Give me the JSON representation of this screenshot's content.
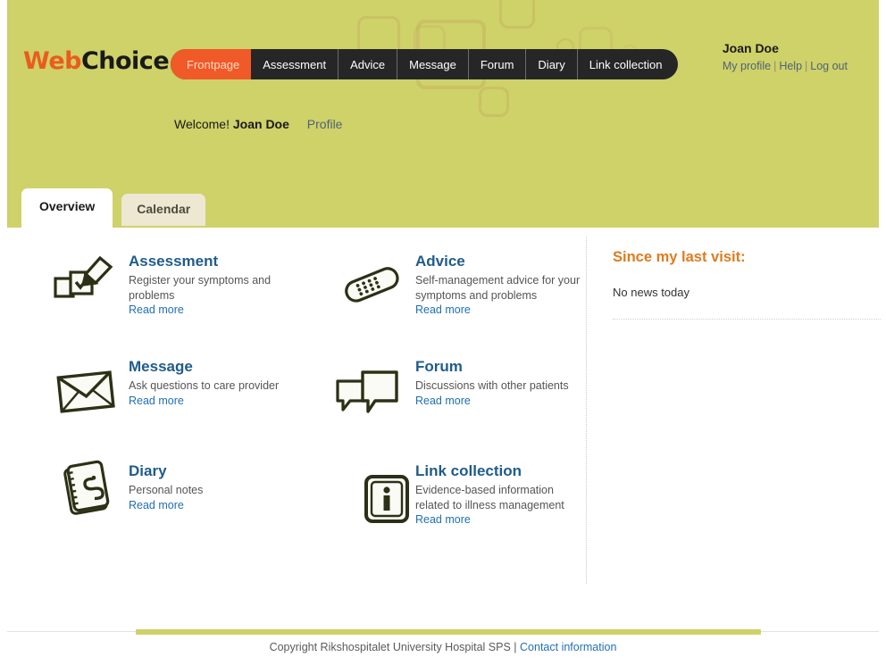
{
  "header": {
    "logo": {
      "part1": "Web",
      "part2": "Choice."
    },
    "nav": [
      {
        "label": "Frontpage",
        "active": true
      },
      {
        "label": "Assessment",
        "active": false
      },
      {
        "label": "Advice",
        "active": false
      },
      {
        "label": "Message",
        "active": false
      },
      {
        "label": "Forum",
        "active": false
      },
      {
        "label": "Diary",
        "active": false
      },
      {
        "label": "Link collection",
        "active": false
      }
    ],
    "user": {
      "name": "Joan Doe",
      "profile_link": "My profile",
      "help_link": "Help",
      "logout_link": "Log out",
      "separator": "|"
    },
    "welcome": {
      "greeting": "Welcome!",
      "name": "Joan Doe",
      "profile_link": "Profile"
    },
    "colors": {
      "background": "#cfd169",
      "nav_background": "#262626",
      "active_tab": "#f05a28",
      "logo_accent": "#ea5c1e"
    }
  },
  "tabs": [
    {
      "label": "Overview",
      "active": true
    },
    {
      "label": "Calendar",
      "active": false
    }
  ],
  "main": {
    "cards": [
      {
        "title": "Assessment",
        "description": "Register your symptoms and problems",
        "link": "Read more",
        "icon": "pencil-checkbox-icon"
      },
      {
        "title": "Advice",
        "description": "Self-management advice for your symptoms and problems",
        "link": "Read more",
        "icon": "bandage-icon"
      },
      {
        "title": "Message",
        "description": "Ask questions to care provider",
        "link": "Read more",
        "icon": "envelope-icon"
      },
      {
        "title": "Forum",
        "description": "Discussions with other patients",
        "link": "Read more",
        "icon": "speech-bubbles-icon"
      },
      {
        "title": "Diary",
        "description": "Personal notes",
        "link": "Read more",
        "icon": "notebook-icon"
      },
      {
        "title": "Link collection",
        "description": "Evidence-based information related to illness management",
        "link": "Read more",
        "icon": "info-square-icon"
      }
    ]
  },
  "sidebar": {
    "title": "Since my last visit:",
    "message": "No news today",
    "title_color": "#e07b1e"
  },
  "footer": {
    "copyright": "Copyright Rikshospitalet University Hospital SPS |",
    "contact_link": "Contact information",
    "bar_color": "#cfd169"
  }
}
